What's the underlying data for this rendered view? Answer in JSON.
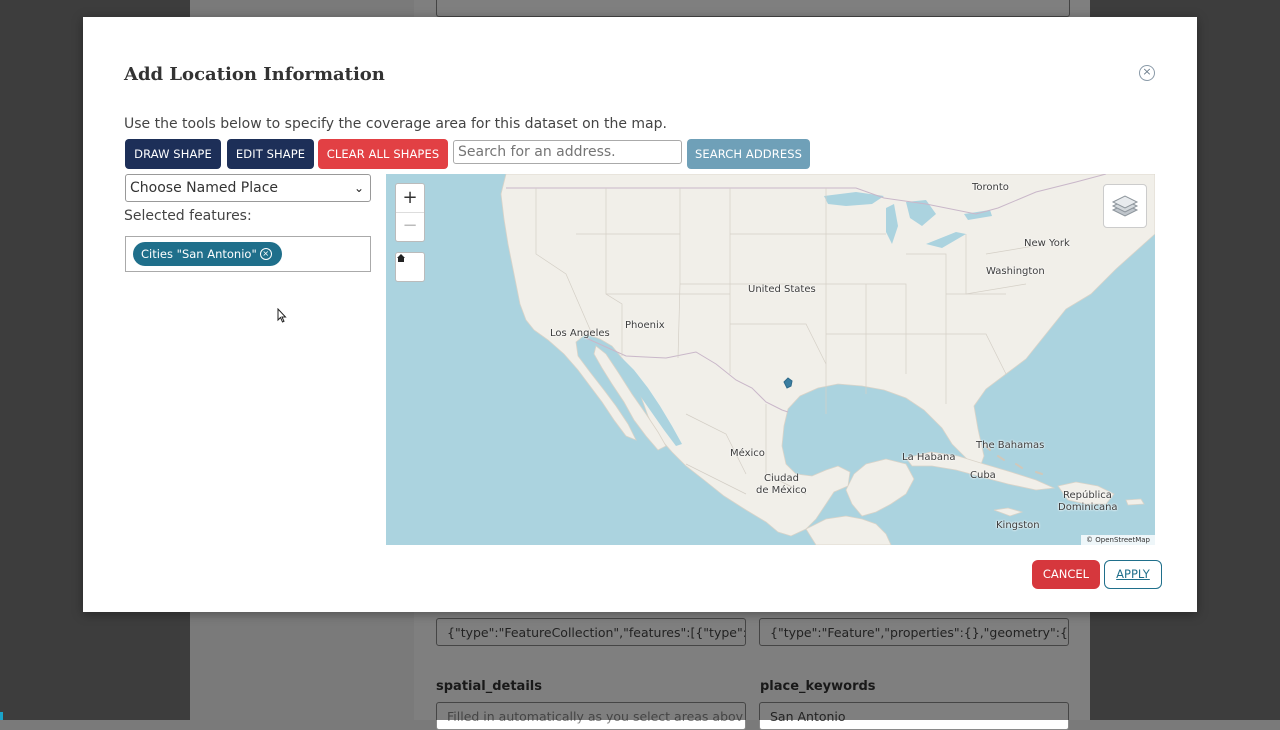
{
  "background": {
    "fields": {
      "geojson_1": "{\"type\":\"FeatureCollection\",\"features\":[{\"type\":\"F",
      "geojson_2": "{\"type\":\"Feature\",\"properties\":{},\"geometry\":{\"ty",
      "spatial_details_label": "spatial_details",
      "spatial_details_placeholder": "Filled in automatically as you select areas abov",
      "place_keywords_label": "place_keywords",
      "place_keywords_value": "San Antonio"
    }
  },
  "modal": {
    "title": "Add Location Information",
    "close_icon": "close-circle-icon",
    "instructions": "Use the tools below to specify the coverage area for this dataset on the map.",
    "toolbar": {
      "draw_shape": "DRAW SHAPE",
      "edit_shape": "EDIT SHAPE",
      "clear_all_shapes": "CLEAR ALL SHAPES",
      "search_placeholder": "Search for an address.",
      "search_address": "SEARCH ADDRESS"
    },
    "named_place": {
      "selected": "Choose Named Place"
    },
    "selected_features_label": "Selected features:",
    "features": [
      {
        "label": "Cities \"San Antonio\""
      }
    ],
    "map": {
      "zoom_in": "+",
      "zoom_out": "−",
      "home_icon": "home-icon",
      "layers_icon": "layers-icon",
      "attribution": "© OpenStreetMap",
      "labels": {
        "toronto": "Toronto",
        "new_york": "New York",
        "washington": "Washington",
        "united_states": "United States",
        "los_angeles": "Los Angeles",
        "phoenix": "Phoenix",
        "mexico": "México",
        "ciudad_de_mexico_1": "Ciudad",
        "ciudad_de_mexico_2": "de México",
        "la_habana": "La Habana",
        "the_bahamas": "The Bahamas",
        "cuba": "Cuba",
        "republica_dominicana_1": "República",
        "republica_dominicana_2": "Dominicana",
        "kingston": "Kingston"
      },
      "colors": {
        "water": "#abd3df",
        "land": "#f1efe9",
        "feature": "#3b7ea1"
      }
    },
    "footer": {
      "cancel": "CANCEL",
      "apply": "APPLY"
    }
  },
  "colors": {
    "navy": "#1d2f58",
    "red": "#e24044",
    "teal": "#1f6f8b",
    "search_button": "#6fa0b8"
  }
}
